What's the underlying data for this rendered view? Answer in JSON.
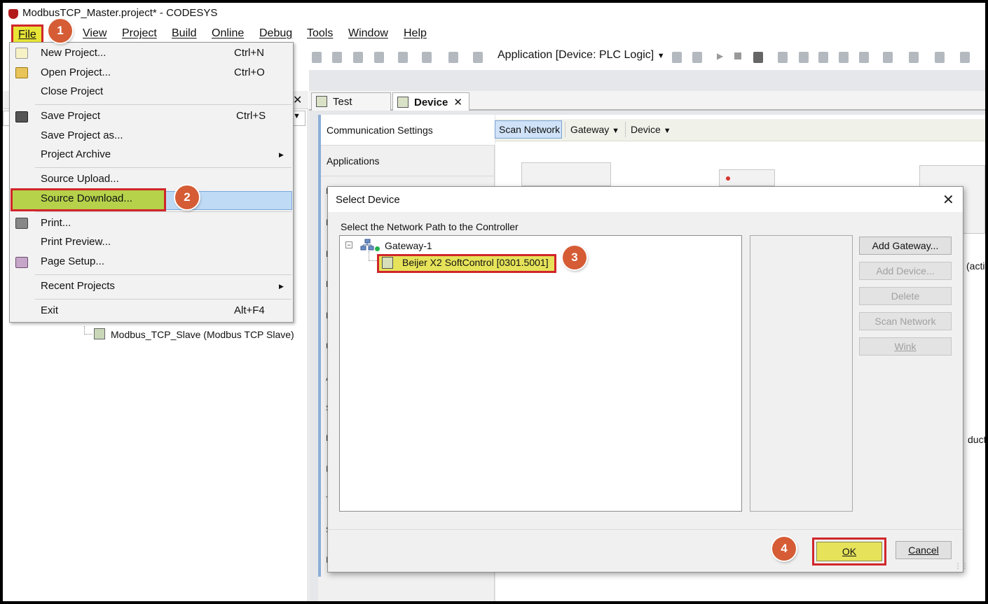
{
  "window": {
    "title": "ModbusTCP_Master.project* - CODESYS"
  },
  "menubar": {
    "file": "File",
    "view": "View",
    "project": "Project",
    "build": "Build",
    "online": "Online",
    "debug": "Debug",
    "tools": "Tools",
    "window": "Window",
    "help": "Help"
  },
  "toolbar": {
    "application": "Application [Device: PLC Logic]"
  },
  "file_menu": {
    "items": [
      {
        "label": "New Project...",
        "shortcut": "Ctrl+N"
      },
      {
        "label": "Open Project...",
        "shortcut": "Ctrl+O"
      },
      {
        "label": "Close Project",
        "shortcut": ""
      },
      {
        "label": "Save Project",
        "shortcut": "Ctrl+S"
      },
      {
        "label": "Save Project as...",
        "shortcut": ""
      },
      {
        "label": "Project Archive",
        "shortcut": ""
      },
      {
        "label": "Source Upload...",
        "shortcut": ""
      },
      {
        "label": "Source Download...",
        "shortcut": ""
      },
      {
        "label": "Print...",
        "shortcut": ""
      },
      {
        "label": "Print Preview...",
        "shortcut": ""
      },
      {
        "label": "Page Setup...",
        "shortcut": ""
      },
      {
        "label": "Recent Projects",
        "shortcut": ""
      },
      {
        "label": "Exit",
        "shortcut": "Alt+F4"
      }
    ]
  },
  "project_tree": {
    "slave": "Modbus_TCP_Slave (Modbus TCP Slave)"
  },
  "editor": {
    "tabs": [
      {
        "label": "Test"
      },
      {
        "label": "Device"
      }
    ],
    "side_tabs": {
      "communication": "Communication Settings",
      "applications": "Applications"
    },
    "side_letters": [
      "B",
      "F",
      "L",
      "F",
      "E",
      "U",
      "A",
      "S",
      "L",
      "I",
      "T",
      "S",
      "I"
    ],
    "toolbar": {
      "scan": "Scan Network",
      "gateway": "Gateway",
      "device": "Device"
    },
    "clipped": {
      "active": "(activ",
      "products": "ducts"
    }
  },
  "dialog": {
    "title": "Select Device",
    "label": "Select the Network Path to the Controller",
    "gateway": "Gateway-1",
    "device": "Beijer X2 SoftControl [0301.5001]",
    "buttons": {
      "add_gateway": "Add Gateway...",
      "add_device": "Add Device...",
      "delete": "Delete",
      "scan_network": "Scan Network",
      "wink": "Wink"
    },
    "ok": "OK",
    "cancel": "Cancel"
  },
  "steps": [
    "1",
    "2",
    "3",
    "4"
  ]
}
